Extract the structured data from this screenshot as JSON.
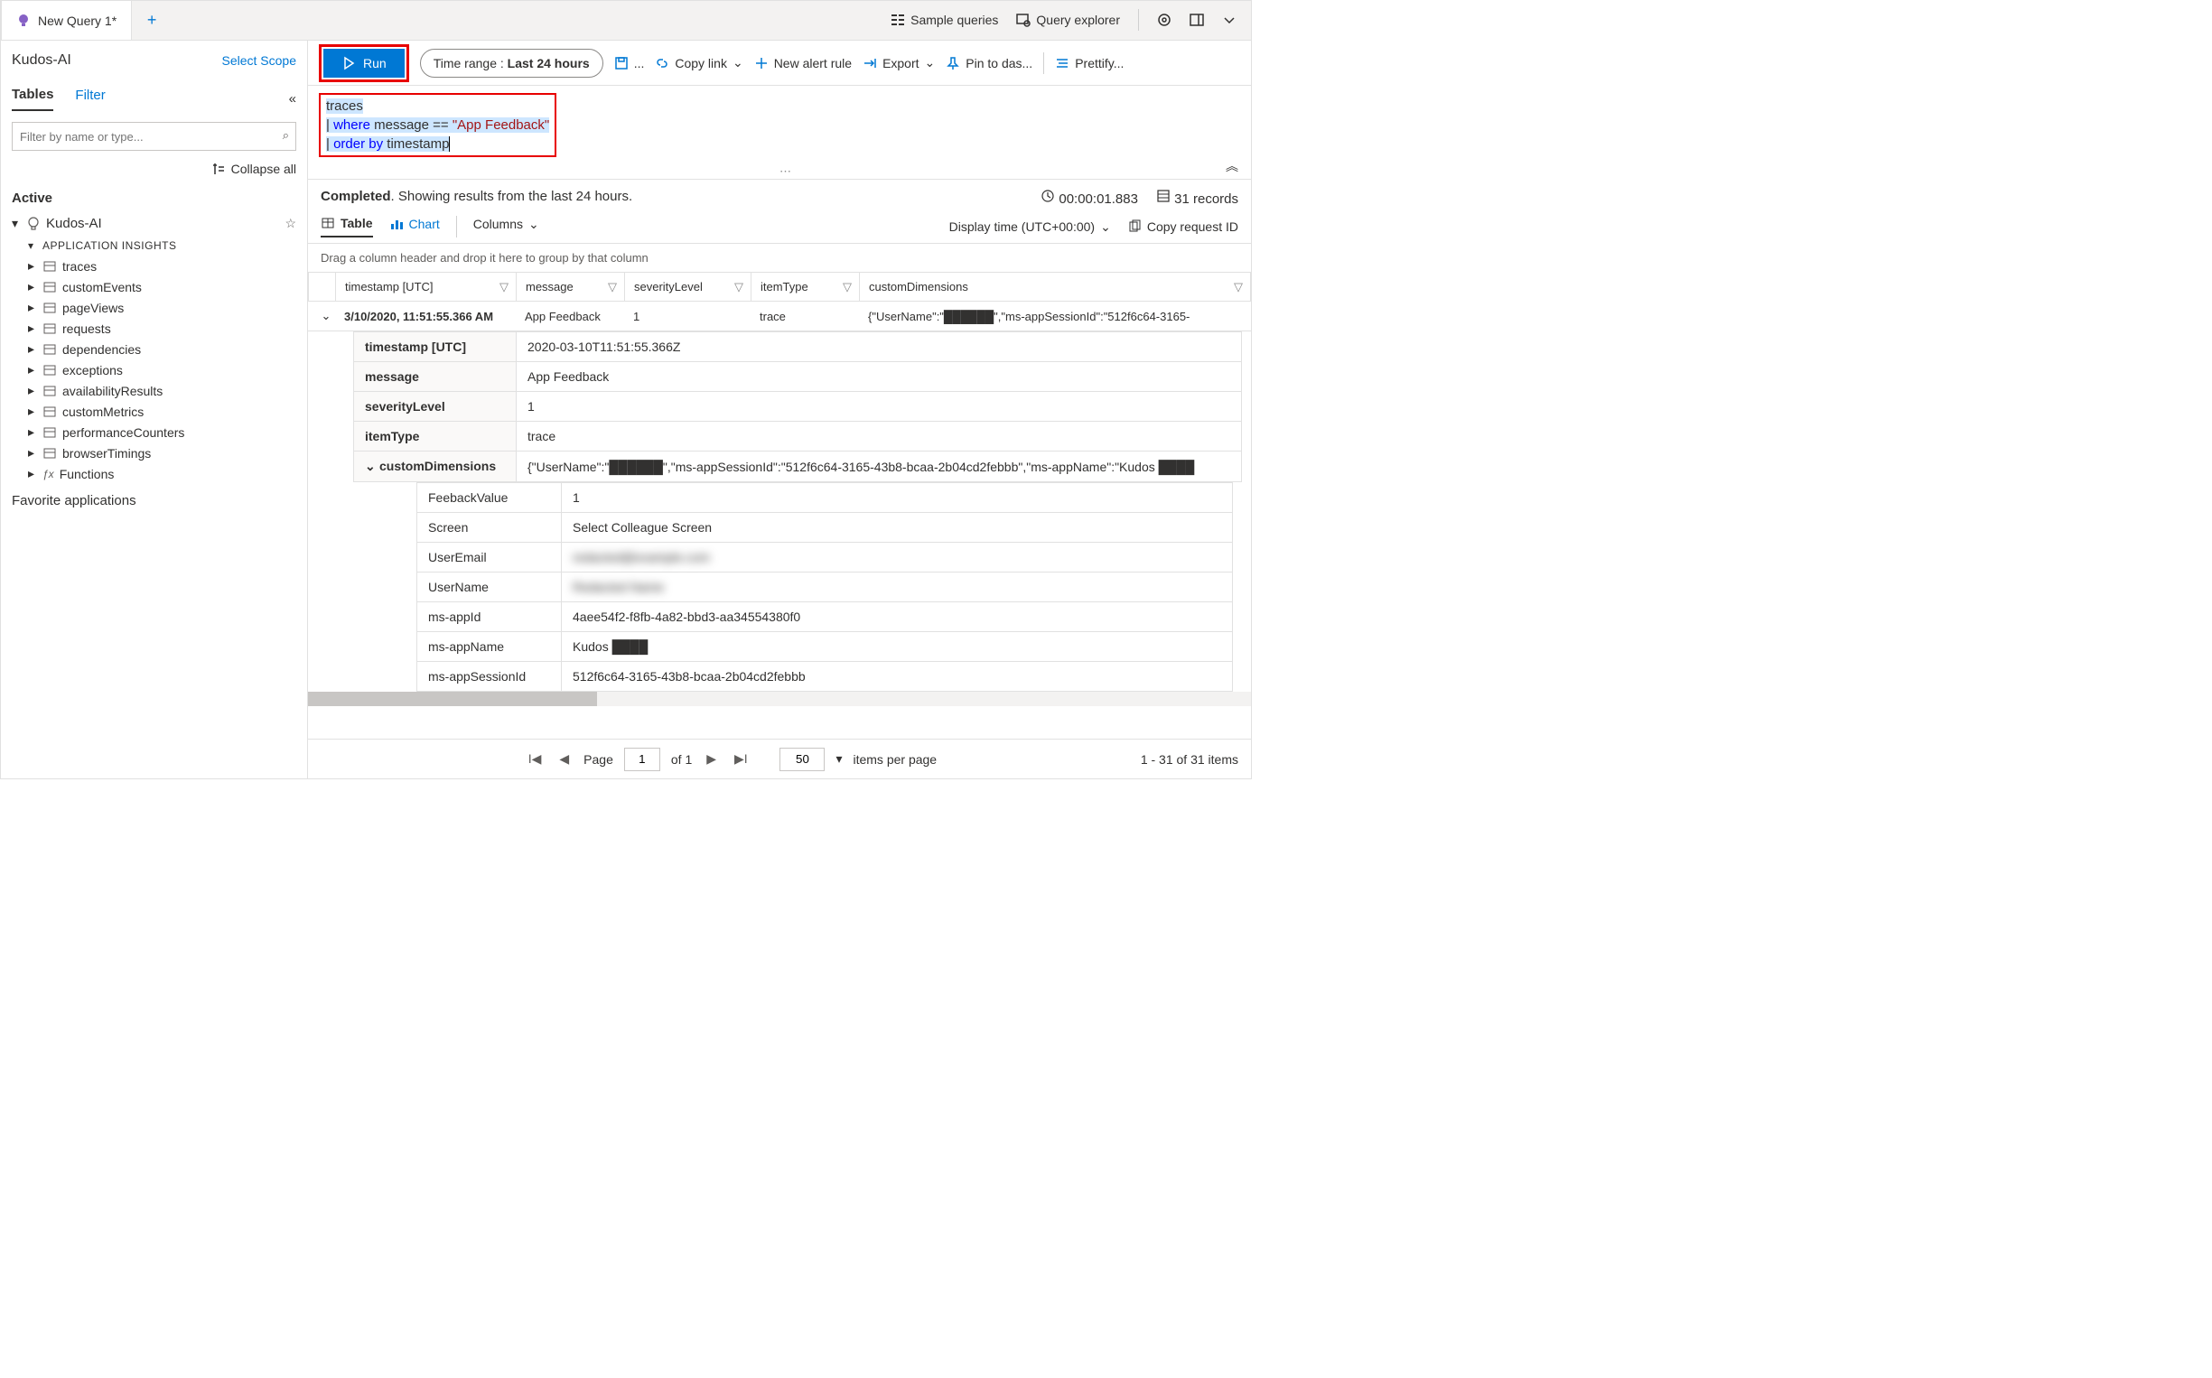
{
  "tab": {
    "title": "New Query 1*"
  },
  "top_actions": {
    "sample": "Sample queries",
    "explorer": "Query explorer"
  },
  "scope": {
    "name": "Kudos-AI",
    "select": "Select Scope"
  },
  "sidebar": {
    "tabs": {
      "tables": "Tables",
      "filter": "Filter"
    },
    "search_placeholder": "Filter by name or type...",
    "collapse": "Collapse all",
    "active_hdr": "Active",
    "root": "Kudos-AI",
    "cat": "APPLICATION INSIGHTS",
    "tables": [
      "traces",
      "customEvents",
      "pageViews",
      "requests",
      "dependencies",
      "exceptions",
      "availabilityResults",
      "customMetrics",
      "performanceCounters",
      "browserTimings"
    ],
    "functions": "Functions",
    "fav": "Favorite applications"
  },
  "toolbar": {
    "run": "Run",
    "time_lbl": "Time range :",
    "time_val": "Last 24 hours",
    "copy": "Copy link",
    "alert": "New alert rule",
    "export": "Export",
    "pin": "Pin to das...",
    "pretty": "Prettify..."
  },
  "query": {
    "l1": "traces",
    "l2a": "where",
    "l2b": "message ==",
    "l2c": "\"App Feedback\"",
    "l3a": "order by",
    "l3b": "timestamp"
  },
  "status": {
    "completed": "Completed",
    "msg": ". Showing results from the last 24 hours.",
    "time": "00:00:01.883",
    "records": "31 records"
  },
  "view": {
    "table": "Table",
    "chart": "Chart",
    "cols": "Columns",
    "display": "Display time (UTC+00:00)",
    "copyreq": "Copy request ID"
  },
  "group_hint": "Drag a column header and drop it here to group by that column",
  "columns": [
    "timestamp [UTC]",
    "message",
    "severityLevel",
    "itemType",
    "customDimensions"
  ],
  "row": {
    "ts": "3/10/2020, 11:51:55.366 AM",
    "msg": "App Feedback",
    "sev": "1",
    "type": "trace",
    "cd_preview": "{\"UserName\":\"██████\",\"ms-appSessionId\":\"512f6c64-3165-"
  },
  "detail": {
    "ts_lbl": "timestamp [UTC]",
    "ts_val": "2020-03-10T11:51:55.366Z",
    "msg_lbl": "message",
    "msg_val": "App Feedback",
    "sev_lbl": "severityLevel",
    "sev_val": "1",
    "it_lbl": "itemType",
    "it_val": "trace",
    "cd_lbl": "customDimensions",
    "cd_val": "{\"UserName\":\"██████\",\"ms-appSessionId\":\"512f6c64-3165-43b8-bcaa-2b04cd2febbb\",\"ms-appName\":\"Kudos ████"
  },
  "cd_rows": [
    {
      "k": "FeebackValue",
      "v": "1"
    },
    {
      "k": "Screen",
      "v": "Select Colleague Screen"
    },
    {
      "k": "UserEmail",
      "v": "redacted@example.com",
      "blur": true
    },
    {
      "k": "UserName",
      "v": "Redacted Name",
      "blur": true
    },
    {
      "k": "ms-appId",
      "v": "4aee54f2-f8fb-4a82-bbd3-aa34554380f0"
    },
    {
      "k": "ms-appName",
      "v": "Kudos ████"
    },
    {
      "k": "ms-appSessionId",
      "v": "512f6c64-3165-43b8-bcaa-2b04cd2febbb"
    }
  ],
  "pager": {
    "page": "Page",
    "of": "of 1",
    "ipp": "items per page",
    "range": "1 - 31 of 31 items",
    "size": "50",
    "cur": "1"
  }
}
